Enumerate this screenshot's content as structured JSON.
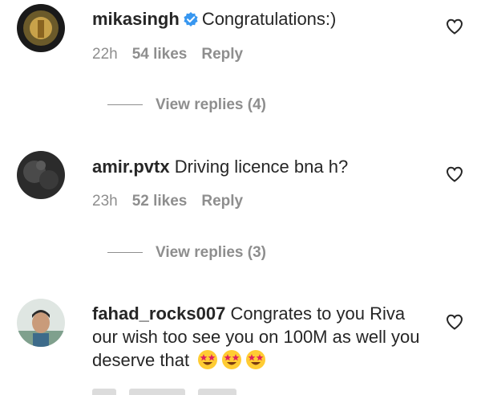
{
  "comments": [
    {
      "username": "mikasingh",
      "verified": true,
      "text": "Congratulations:)",
      "time": "22h",
      "likes": "54 likes",
      "reply": "Reply",
      "view_replies": "View replies (4)"
    },
    {
      "username": "amir.pvtx",
      "verified": false,
      "text": "Driving licence bna h?",
      "time": "23h",
      "likes": "52 likes",
      "reply": "Reply",
      "view_replies": "View replies (3)"
    },
    {
      "username": "fahad_rocks007",
      "verified": false,
      "text": "Congrates to you Riva our wish too see you on 100M as well you deserve that",
      "emoji": "star-struck-emoji"
    }
  ],
  "colors": {
    "text": "#262626",
    "muted": "#8e8e8e",
    "verified": "#3897f0"
  }
}
